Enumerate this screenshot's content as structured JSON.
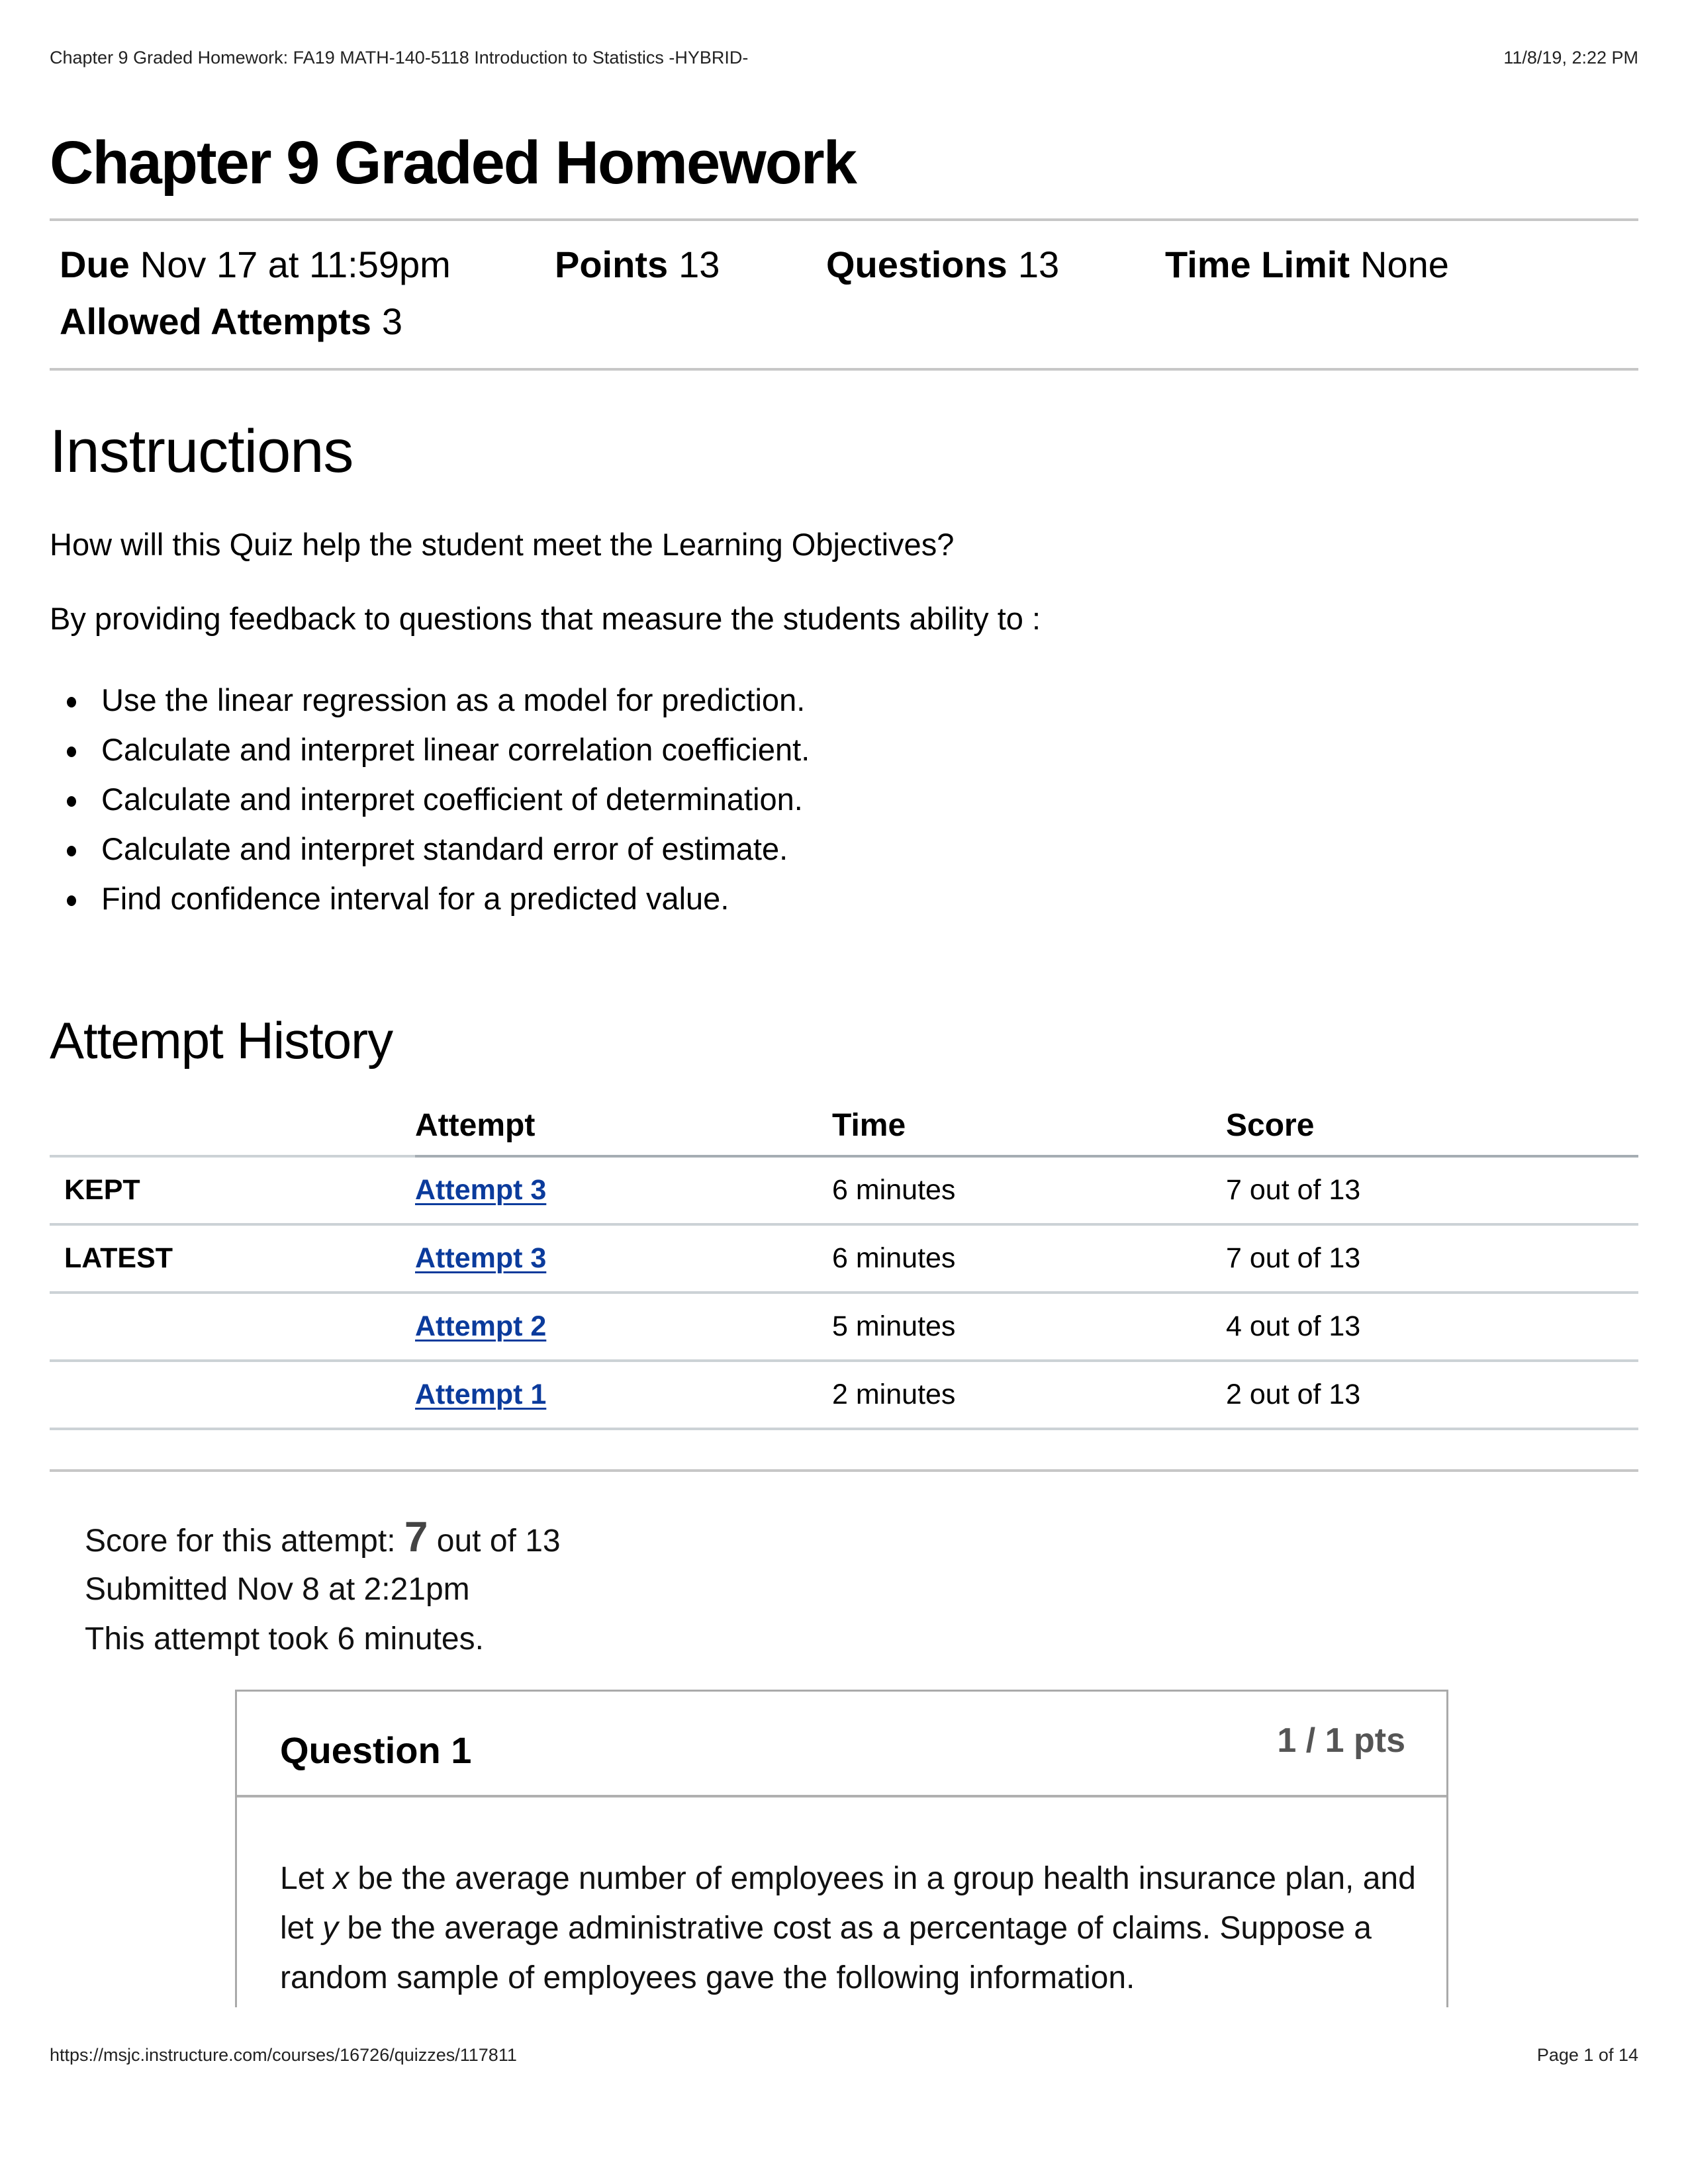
{
  "print_header": {
    "title": "Chapter 9 Graded Homework: FA19 MATH-140-5118 Introduction to Statistics -HYBRID-",
    "datetime": "11/8/19, 2:22 PM"
  },
  "page_title": "Chapter 9 Graded Homework",
  "meta": {
    "due_label": "Due",
    "due_value": "Nov 17 at 11:59pm",
    "points_label": "Points",
    "points_value": "13",
    "questions_label": "Questions",
    "questions_value": "13",
    "time_limit_label": "Time Limit",
    "time_limit_value": "None",
    "allowed_attempts_label": "Allowed Attempts",
    "allowed_attempts_value": "3"
  },
  "instructions": {
    "heading": "Instructions",
    "question": "How will this Quiz help the student meet the Learning Objectives?",
    "intro": "By  providing feedback to questions that measure the students ability to :",
    "objectives": [
      "Use the linear regression as a model for prediction.",
      "Calculate and interpret linear correlation coefficient.",
      "Calculate and interpret coefficient of determination.",
      "Calculate and interpret standard error of estimate.",
      "Find confidence interval  for a predicted value."
    ]
  },
  "attempt_history": {
    "heading": "Attempt History",
    "columns": [
      "",
      "Attempt",
      "Time",
      "Score"
    ],
    "rows": [
      {
        "label": "KEPT",
        "attempt": "Attempt 3",
        "time": "6 minutes",
        "score": "7 out of 13"
      },
      {
        "label": "LATEST",
        "attempt": "Attempt 3",
        "time": "6 minutes",
        "score": "7 out of 13"
      },
      {
        "label": "",
        "attempt": "Attempt 2",
        "time": "5 minutes",
        "score": "4 out of 13"
      },
      {
        "label": "",
        "attempt": "Attempt 1",
        "time": "2 minutes",
        "score": "2 out of 13"
      }
    ]
  },
  "attempt_summary": {
    "score_prefix": "Score for this attempt: ",
    "score_value": "7",
    "score_suffix": " out of 13",
    "submitted": "Submitted Nov 8 at 2:21pm",
    "duration": "This attempt took 6 minutes."
  },
  "question": {
    "title": "Question 1",
    "points": "1 / 1 pts",
    "text_parts": {
      "p1": "Let ",
      "x": "x",
      "p2": " be the average number of employees in a group health insurance plan, and let ",
      "y": "y",
      "p3": " be the average administrative cost as a percentage of claims. Suppose a random sample of employees gave the following information."
    }
  },
  "footer": {
    "url": "https://msjc.instructure.com/courses/16726/quizzes/117811",
    "page": "Page 1 of 14"
  },
  "colors": {
    "link": "#0b3b9c",
    "rule": "#c7c7c7",
    "points_text": "#555555"
  }
}
